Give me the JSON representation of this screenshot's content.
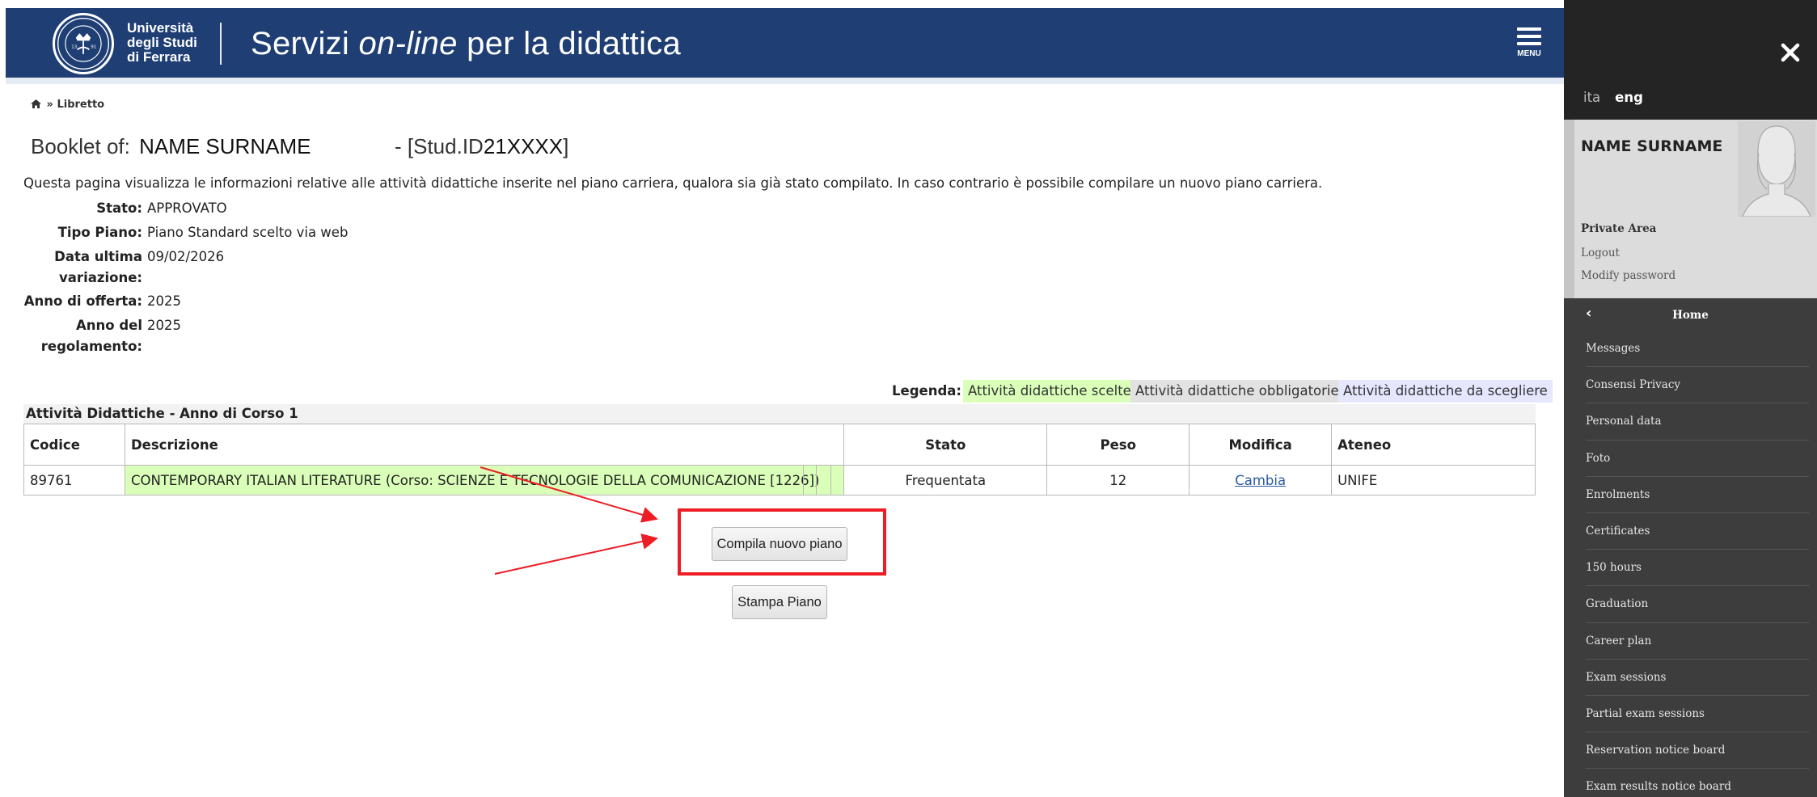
{
  "header": {
    "logo_line1": "Università",
    "logo_line2": "degli Studi",
    "logo_line3": "di Ferrara",
    "title_part1": "Servizi ",
    "title_italic": "on-line",
    "title_part2": " per la didattica",
    "menu_label": "MENU"
  },
  "breadcrumb": {
    "separator": "»",
    "current": "Libretto"
  },
  "booklet": {
    "prefix": "Booklet of:",
    "name": "NAME SURNAME",
    "studid_prefix": "- [Stud.ID",
    "studid": "21XXXX",
    "studid_suffix": "]"
  },
  "intro_text": "Questa pagina visualizza le informazioni relative alle attività didattiche inserite nel piano carriera, qualora sia già stato compilato. In caso contrario è possibile compilare un nuovo piano carriera.",
  "plan_info": [
    {
      "label": "Stato:",
      "value": "APPROVATO"
    },
    {
      "label": "Tipo Piano:",
      "value": "Piano Standard scelto via web"
    },
    {
      "label": "Data ultima variazione:",
      "value": "09/02/2026"
    },
    {
      "label": "Anno di offerta:",
      "value": "2025"
    },
    {
      "label": "Anno del regolamento:",
      "value": "2025"
    }
  ],
  "legend": {
    "label": "Legenda:",
    "items": [
      {
        "text": "Attività didattiche scelte",
        "color": "#d9ffb8"
      },
      {
        "text": "Attività didattiche obbligatorie",
        "color": "#e2e2e2"
      },
      {
        "text": "Attività didattiche da scegliere",
        "color": "#e6e6ff"
      }
    ]
  },
  "table": {
    "caption": "Attività Didattiche - Anno di Corso 1",
    "headers": [
      "Codice",
      "Descrizione",
      "Stato",
      "Peso",
      "Modifica",
      "Ateneo"
    ],
    "rows": [
      {
        "codice": "89761",
        "descrizione": "CONTEMPORARY ITALIAN LITERATURE (Corso: SCIENZE E TECNOLOGIE DELLA COMUNICAZIONE [1226])",
        "stato": "Frequentata",
        "peso": "12",
        "modifica": "Cambia",
        "ateneo": "UNIFE"
      }
    ]
  },
  "buttons": {
    "compila": "Compila nuovo piano",
    "stampa": "Stampa Piano"
  },
  "annotation": {
    "highlight_color": "#ee1c24"
  },
  "sidebar": {
    "lang_ita": "ita",
    "lang_eng": "eng",
    "user_name": "NAME SURNAME",
    "private_area": "Private Area",
    "logout": "Logout",
    "modify_password": "Modify password",
    "home": "Home",
    "items": [
      "Messages",
      "Consensi Privacy",
      "Personal data",
      "Foto",
      "Enrolments",
      "Certificates",
      "150 hours",
      "Graduation",
      "Career plan",
      "Exam sessions",
      "Partial exam sessions",
      "Reservation notice board",
      "Exam results notice board"
    ]
  },
  "colors": {
    "header_bg": "#1f3f74",
    "sidebar_bg": "#3d3d3d",
    "sidebar_top_bg": "#242424"
  }
}
